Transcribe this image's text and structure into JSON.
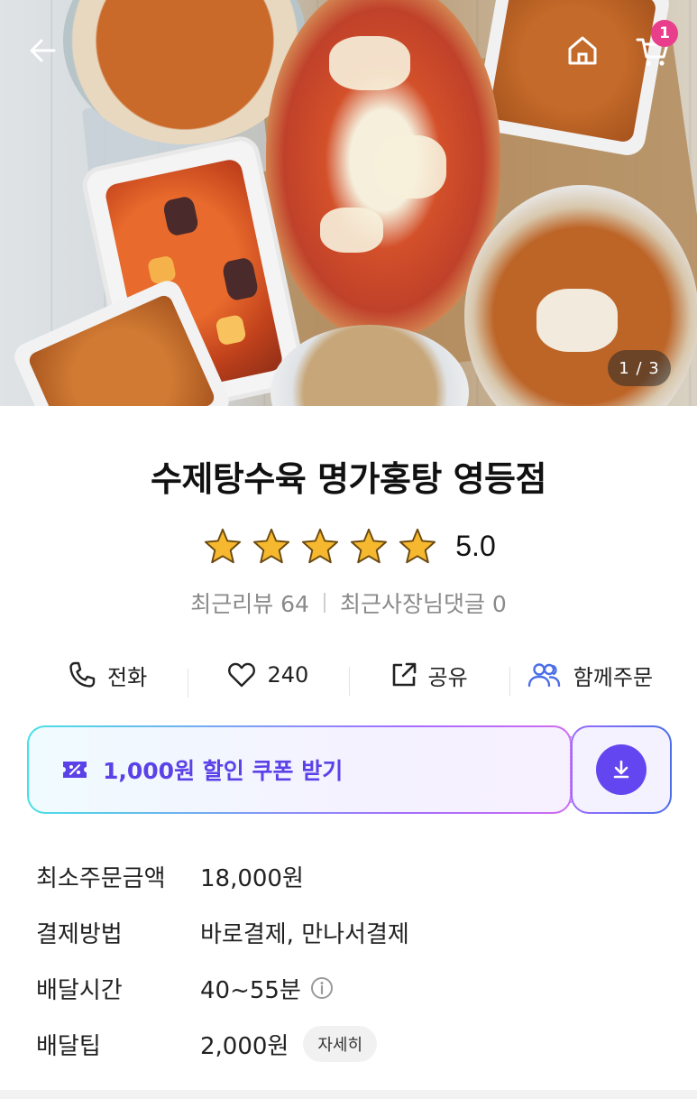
{
  "hero": {
    "image_alt": "food-photo",
    "page_indicator": "1 / 3",
    "cart_count": "1"
  },
  "store": {
    "name": "수제탕수육 명가홍탕 영등점",
    "rating": "5.0",
    "stars_filled": 5,
    "recent_reviews": "최근리뷰 64",
    "recent_owner_replies": "최근사장님댓글 0"
  },
  "actions": {
    "call": "전화",
    "likes": "240",
    "share": "공유",
    "group_order": "함께주문"
  },
  "coupon": {
    "label": "1,000원 할인 쿠폰 받기"
  },
  "details": {
    "min_order_label": "최소주문금액",
    "min_order_value": "18,000원",
    "payment_label": "결제방법",
    "payment_value": "바로결제, 만나서결제",
    "delivery_time_label": "배달시간",
    "delivery_time_value": "40~55분",
    "delivery_tip_label": "배달팁",
    "delivery_tip_value": "2,000원",
    "detail_button": "자세히"
  },
  "colors": {
    "accent": "#6446f0",
    "badge": "#e83e8c",
    "star": "#f5b82e"
  }
}
